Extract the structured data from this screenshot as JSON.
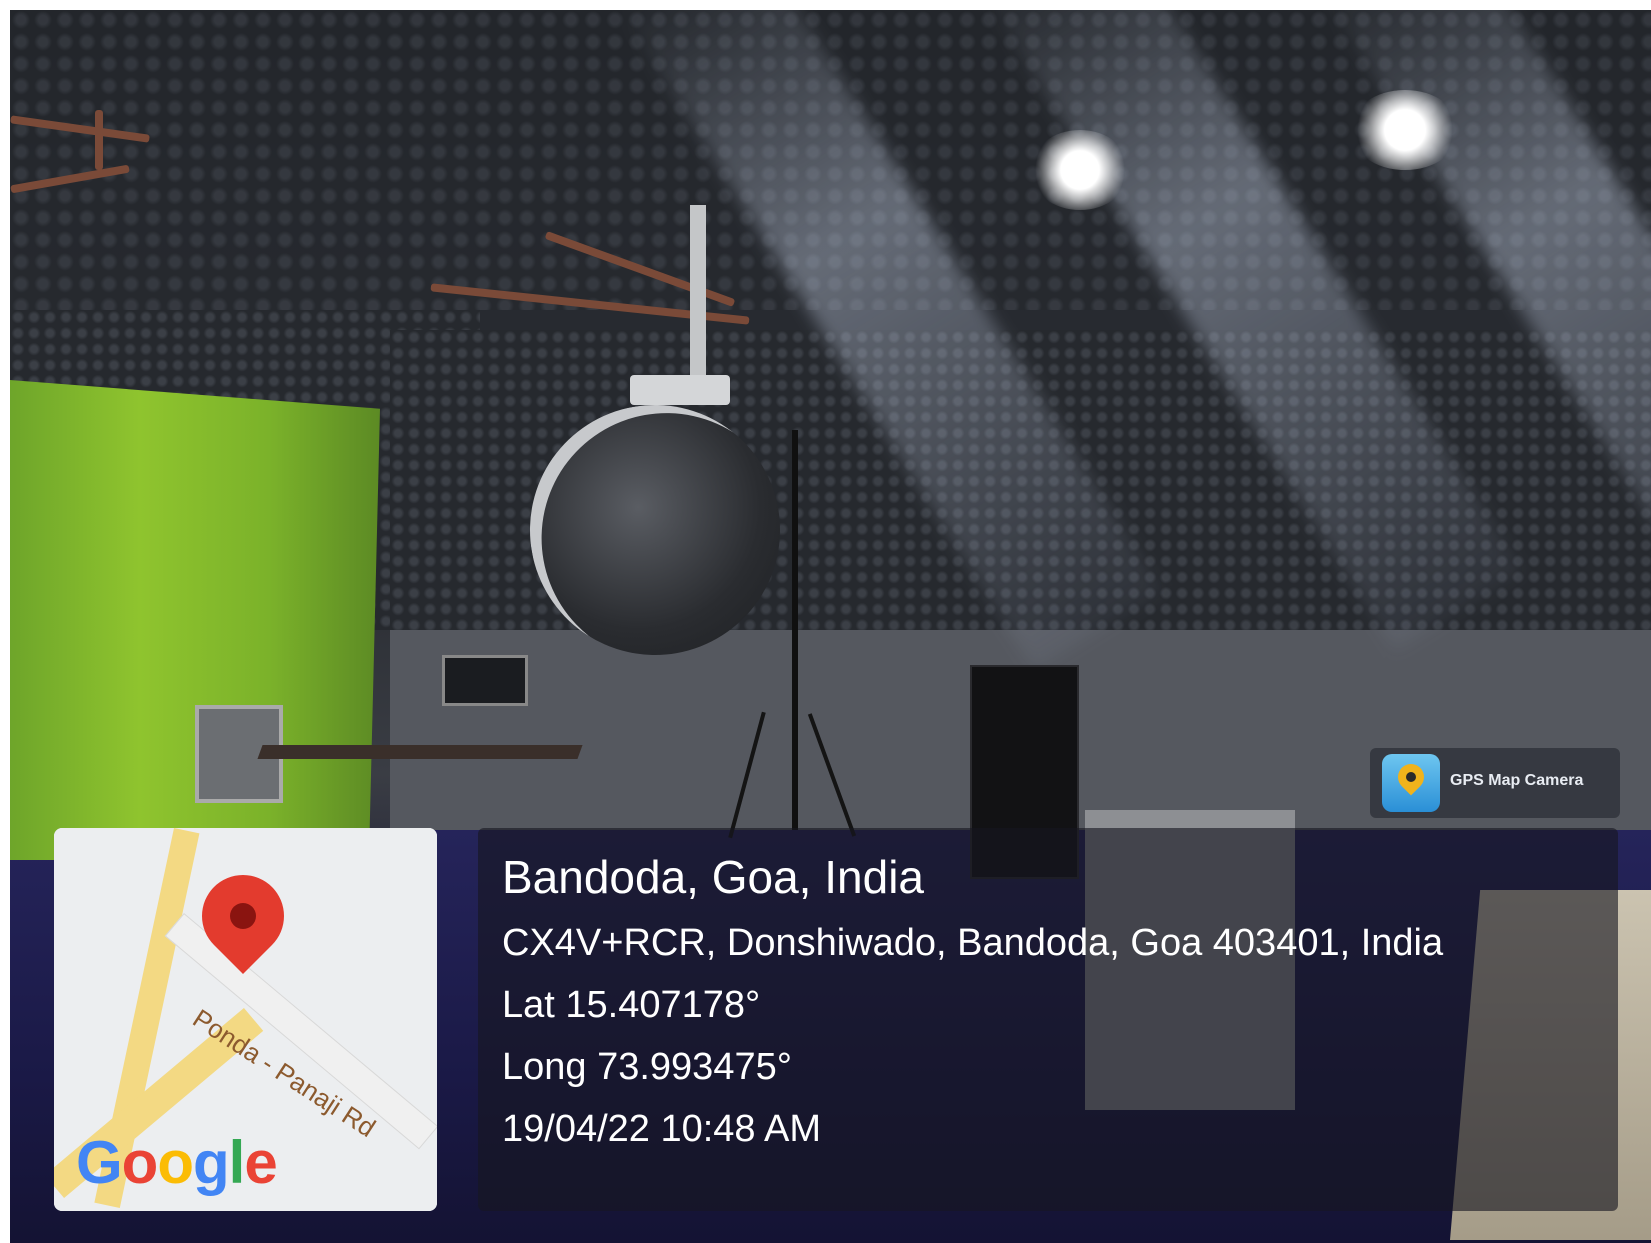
{
  "location": {
    "place_title": "Bandoda, Goa, India",
    "address": "CX4V+RCR, Donshiwado, Bandoda, Goa 403401, India",
    "latitude": "Lat 15.407178°",
    "longitude": "Long 73.993475°",
    "datetime": "19/04/22 10:48 AM"
  },
  "map": {
    "road_label": "Ponda - Panaji Rd",
    "provider_logo": {
      "letters": [
        "G",
        "o",
        "o",
        "g",
        "l",
        "e"
      ],
      "colors": [
        "#4285F4",
        "#EA4335",
        "#FBBC05",
        "#4285F4",
        "#34A853",
        "#EA4335"
      ]
    },
    "pin_color": "#e33b2e"
  },
  "app_badge": {
    "label": "GPS Map Camera",
    "icon": "map-pin-icon"
  },
  "scene": {
    "description_icon": "photo-studio-scene",
    "accent_colors": {
      "green_screen": "#8fc42e",
      "floor": "#1a1946"
    }
  }
}
